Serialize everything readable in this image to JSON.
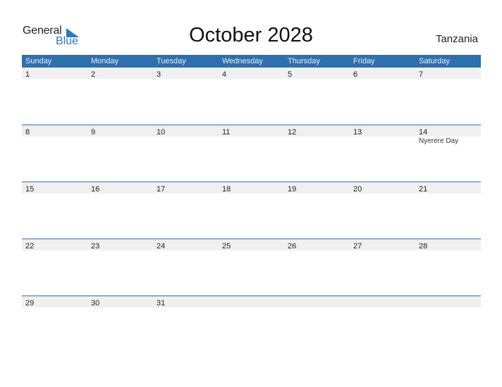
{
  "logo": {
    "word1": "General",
    "word2": "Blue"
  },
  "title": "October 2028",
  "country": "Tanzania",
  "colors": {
    "header_bg": "#2e6fad",
    "accent": "#2a78c2",
    "strip_bg": "#f0f0f0"
  },
  "weekdays": [
    "Sunday",
    "Monday",
    "Tuesday",
    "Wednesday",
    "Thursday",
    "Friday",
    "Saturday"
  ],
  "weeks": [
    [
      {
        "d": "1"
      },
      {
        "d": "2"
      },
      {
        "d": "3"
      },
      {
        "d": "4"
      },
      {
        "d": "5"
      },
      {
        "d": "6"
      },
      {
        "d": "7"
      }
    ],
    [
      {
        "d": "8"
      },
      {
        "d": "9"
      },
      {
        "d": "10"
      },
      {
        "d": "11"
      },
      {
        "d": "12"
      },
      {
        "d": "13"
      },
      {
        "d": "14",
        "holiday": "Nyerere Day"
      }
    ],
    [
      {
        "d": "15"
      },
      {
        "d": "16"
      },
      {
        "d": "17"
      },
      {
        "d": "18"
      },
      {
        "d": "19"
      },
      {
        "d": "20"
      },
      {
        "d": "21"
      }
    ],
    [
      {
        "d": "22"
      },
      {
        "d": "23"
      },
      {
        "d": "24"
      },
      {
        "d": "25"
      },
      {
        "d": "26"
      },
      {
        "d": "27"
      },
      {
        "d": "28"
      }
    ],
    [
      {
        "d": "29"
      },
      {
        "d": "30"
      },
      {
        "d": "31"
      },
      {
        "d": ""
      },
      {
        "d": ""
      },
      {
        "d": ""
      },
      {
        "d": ""
      }
    ]
  ]
}
